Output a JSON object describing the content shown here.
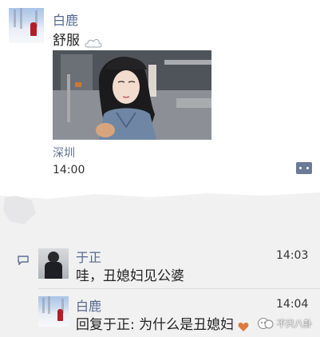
{
  "post": {
    "author": "白鹿",
    "text": "舒服",
    "location": "深圳",
    "time": "14:00"
  },
  "comments": [
    {
      "author": "于正",
      "time": "14:03",
      "text": "哇，丑媳妇见公婆"
    },
    {
      "author": "白鹿",
      "time": "14:04",
      "text": "回复于正: 为什么是丑媳妇"
    }
  ],
  "watermark": "不只八卦",
  "icons": {
    "cloud": "cloud-icon",
    "more": "more-options-icon",
    "comment": "comment-icon",
    "heart": "heart-icon"
  },
  "colors": {
    "name": "#56688f",
    "location": "#5f6f8f",
    "heart": "#e07a3e"
  }
}
